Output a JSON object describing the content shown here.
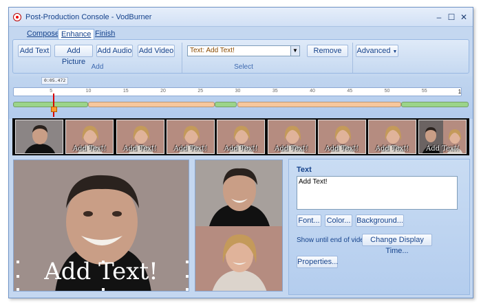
{
  "window": {
    "title": "Post-Production Console - VodBurner"
  },
  "window_controls": {
    "minimize": "–",
    "maximize": "☐",
    "close": "✕"
  },
  "tabs": [
    {
      "label": "Compose"
    },
    {
      "label": "Enhance",
      "active": true
    },
    {
      "label": "Finish"
    }
  ],
  "ribbon": {
    "add_group": {
      "label": "Add",
      "buttons": [
        "Add Text",
        "Add Picture",
        "Add Audio",
        "Add Video"
      ]
    },
    "select_group": {
      "label": "Select",
      "selected_value": "Text: Add Text!"
    },
    "remove_label": "Remove",
    "advanced_label": "Advanced"
  },
  "timeline": {
    "current_time": "0:05.472",
    "ticks": [
      "5",
      "10",
      "15",
      "20",
      "25",
      "30",
      "35",
      "40",
      "45",
      "50",
      "55"
    ],
    "end_label": "1",
    "playhead_seconds": 5.472,
    "segments": [
      {
        "start": 0,
        "end": 10,
        "color": "#9bd48a"
      },
      {
        "start": 10,
        "end": 27,
        "color": "#f7c79c"
      },
      {
        "start": 27,
        "end": 30,
        "color": "#9bd48a"
      },
      {
        "start": 30,
        "end": 52,
        "color": "#f7c79c"
      },
      {
        "start": 52,
        "end": 61,
        "color": "#9bd48a"
      }
    ]
  },
  "thumbnails": [
    {
      "subject": "man",
      "caption": ""
    },
    {
      "subject": "woman",
      "caption": "Add Text!"
    },
    {
      "subject": "woman",
      "caption": "Add Text!"
    },
    {
      "subject": "woman",
      "caption": "Add Text!"
    },
    {
      "subject": "woman",
      "caption": "Add Text!"
    },
    {
      "subject": "woman",
      "caption": "Add Text!"
    },
    {
      "subject": "woman",
      "caption": "Add Text!"
    },
    {
      "subject": "woman",
      "caption": "Add Text!"
    },
    {
      "subject": "both",
      "caption": "Add Text!"
    }
  ],
  "preview": {
    "caption": "Add Text!"
  },
  "properties": {
    "title": "Text",
    "text_value": "Add Text!",
    "font_button": "Font...",
    "color_button": "Color...",
    "background_button": "Background...",
    "display_text": "Show until end of video",
    "change_time_button": "Change Display Time...",
    "properties_button": "Properties..."
  },
  "colors": {
    "accent": "#15428b",
    "frame": "#c4d7f0",
    "playhead": "#d80000"
  }
}
